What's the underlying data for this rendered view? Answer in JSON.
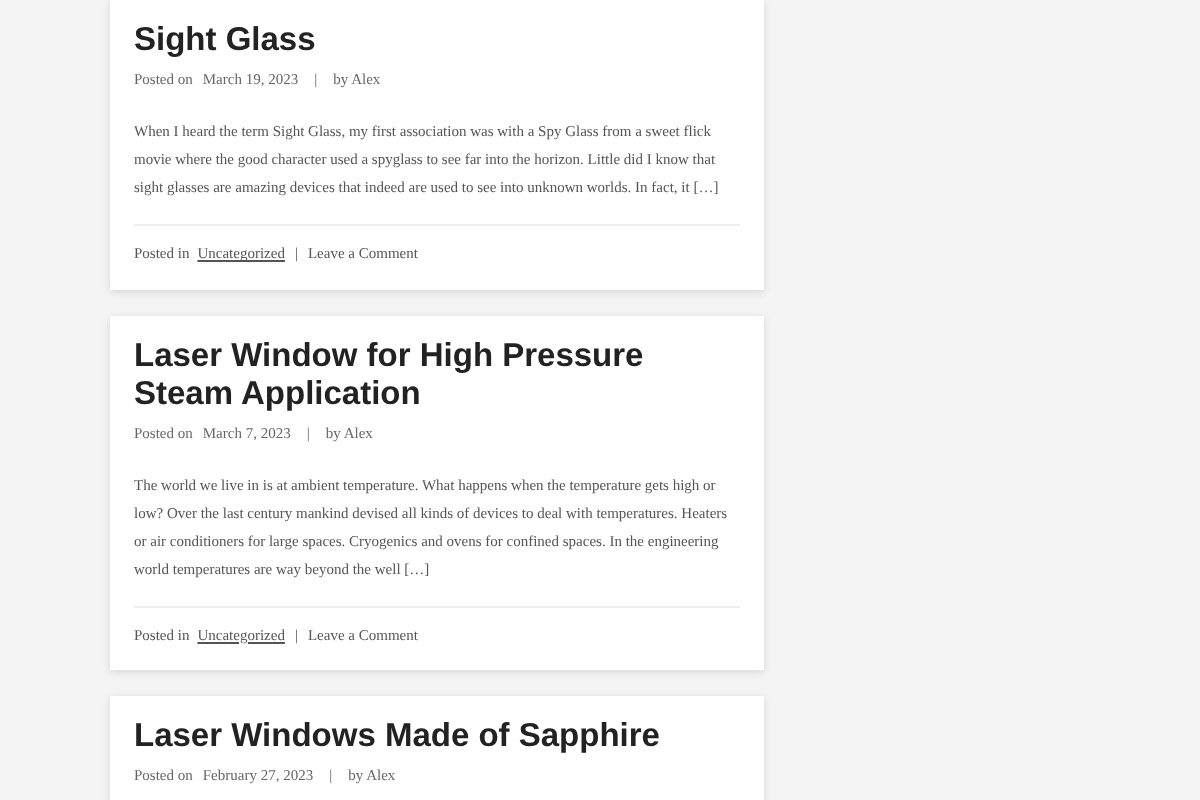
{
  "posts": [
    {
      "title": "Sight Glass",
      "posted_on_label": "Posted on",
      "date": "March 19, 2023",
      "separator": "|",
      "author": "by Alex",
      "excerpt": "When I heard the term Sight Glass, my first association was with a Spy Glass from a sweet flick movie where the good character used a spyglass to see far into the horizon. Little did I know that sight glasses are amazing devices that indeed are used to see into unknown worlds. In fact, it […]",
      "posted_in_label": "Posted in",
      "category": "Uncategorized",
      "footer_separator": "|",
      "comment_link": "Leave a Comment"
    },
    {
      "title": "Laser Window for High Pressure Steam Application",
      "posted_on_label": "Posted on",
      "date": "March 7, 2023",
      "separator": "|",
      "author": "by Alex",
      "excerpt": "The world we live in is at ambient temperature. What happens when the temperature gets high or low? Over the last century mankind devised all kinds of devices to deal with temperatures. Heaters or air conditioners for large spaces. Cryogenics and ovens for confined spaces. In the engineering world temperatures are way beyond the well […]",
      "posted_in_label": "Posted in",
      "category": "Uncategorized",
      "footer_separator": "|",
      "comment_link": "Leave a Comment"
    },
    {
      "title": "Laser Windows Made of Sapphire",
      "posted_on_label": "Posted on",
      "date": "February 27, 2023",
      "separator": "|",
      "author": "by Alex"
    }
  ]
}
